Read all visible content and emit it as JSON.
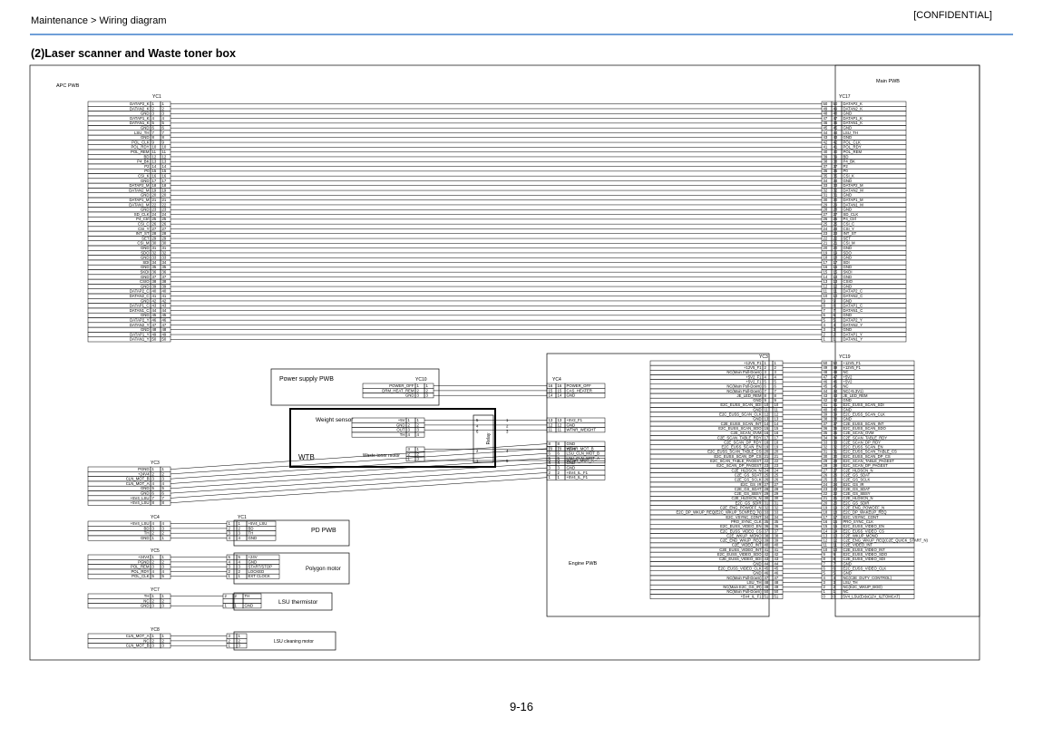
{
  "header": {
    "breadcrumb": "Maintenance > Wiring diagram",
    "confidential": "[CONFIDENTIAL]",
    "section_title": "(2)Laser scanner and Waste toner box",
    "page_number": "9-16"
  },
  "boards": {
    "apc": "APC PWB",
    "main": "Main PWB",
    "engine": "Engine PWB",
    "power": "Power supply PWB",
    "pd": "PD PWB",
    "weight": "Weight sensor",
    "waste_motor": "Waste toner motor",
    "wtb": "WTB",
    "relay": "Relay",
    "polygon": "Polygon motor",
    "lsu_th": "LSU thermistor",
    "lsu_clean": "LSU cleaning motor"
  },
  "connectors": {
    "yc1": "YC1",
    "yc17": "YC17",
    "yc3": "YC3",
    "yc19": "YC19",
    "yc10": "YC10",
    "yc4": "YC4",
    "yc5": "YC5",
    "yc7": "YC7",
    "yc8": "YC8"
  },
  "yc1_signals": [
    "DATAP2_K",
    "DATAN2_K",
    "GND",
    "DATAP1_K",
    "DATAN1_K",
    "GND",
    "LSU_TH",
    "GND",
    "POL_CLK",
    "POL_RDY",
    "POL_REM",
    "BD",
    "P4_BK",
    "P2",
    "P0",
    "CSI_K",
    "GND",
    "DATAP2_M",
    "DATAN2_M",
    "GND",
    "DATAP1_M",
    "DATAN1_M",
    "GND",
    "SD_CLK",
    "P4_Ctrl",
    "CSI_C",
    "CSI_Y",
    "INT_ST",
    "SET",
    "CSI_M",
    "GND",
    "SDO",
    "GND",
    "SDI",
    "GND",
    "SKDI",
    "GND",
    "CSIO",
    "GND",
    "DATAP2_C",
    "DATAN2_C",
    "GND",
    "DATAP1_C",
    "DATAN1_C",
    "GND",
    "DATAP2_Y",
    "DATAN2_Y",
    "GND",
    "DATAP1_Y",
    "DATAN1_Y"
  ],
  "yc17_signals": [
    "DATAP2_K",
    "DATAN2_K",
    "GND",
    "DATAP1_K",
    "DATAN1_K",
    "GND",
    "LSU_TH",
    "GND",
    "POL_CLK",
    "POL_RDY",
    "POL_REM",
    "BD",
    "P4_BK",
    "P2",
    "P0",
    "CSI_K",
    "GND",
    "DATAP2_M",
    "DATAN2_M",
    "GND",
    "DATAP1_M",
    "DATAN1_M",
    "GND",
    "SD_CLK",
    "P4_Ctrl",
    "CSI_C",
    "CSI_Y",
    "INT_ST",
    "SET",
    "CSI_M",
    "GND",
    "SDO",
    "GND",
    "SDI",
    "GND",
    "SKDI",
    "GND",
    "CSIO",
    "GND",
    "DATAP2_C",
    "DATAN2_C",
    "GND",
    "DATAP1_C",
    "DATAN1_C",
    "GND",
    "DATAP2_Y",
    "DATAN2_Y",
    "GND",
    "DATAP1_Y",
    "DATAN1_Y"
  ],
  "yc3_signals": [
    "+12V5_F1",
    "+12V5_F1",
    "NC(Main Pull-Down)",
    "+5V2_F1",
    "+5V2_F1",
    "NC(Main Pull-Down)",
    "NC(Main Pull-Down)",
    "JE_LED_REM",
    "GND",
    "E2C_EUSS_SCAN_SDI",
    "GND",
    "E2C_EUSS_SCAN_CLK",
    "GND",
    "C2E_EUSS_SCAN_INT",
    "E2C_EUSS_SCAN_SDO",
    "C2E_SCAN_OVM",
    "C2E_SCAN_TABLE_RDY",
    "C2E_SCAN_DP_RDY",
    "E2C_EUSS_SCAN_EN",
    "E2C_EUSS_SCAN_TABLE_CS",
    "E2C_EUSS_SCAN_DP_CS",
    "E2C_SCAN_TABLE_PAGEST",
    "E2C_SCAN_DP_PAGEST",
    "C2E_HLDSCN_N",
    "C2E_GS_SDAT",
    "C2E_GS_SCLK",
    "E2C_GS_IR",
    "C2E_GS_SDAT",
    "C2E_GS_SBSY",
    "C2E_HLDSCN_N",
    "E2C_GS_SDIR",
    "C2E_ENG_POWOFF_N",
    "E2C_DP_WKUP_REQ(E2C_WKUP_SCNREQ_N)",
    "E2C_VSYNC_CONT",
    "PRO_SYNC_CLK",
    "E2C_EUSS_VIDEO_EN",
    "E2C_EUSS_VIDEO_CS",
    "C2E_WKUP_MONO",
    "C2E_END_WKUP_REQ",
    "C2E_VIDEO_INT",
    "C2E_EUSS_VIDEO_INT",
    "E2C_EUSS_VIDEO_SDO",
    "C2E_EUSS_VIDEO_SDI",
    "GND",
    "E2C_EUSS_VIDEO_CLK",
    "GND",
    "NC(Main Pull-Down)",
    "LSU_TH",
    "NC(Main E2C_GS_IR)",
    "NC(Main Pull-Down)"
  ],
  "yc3_last": "+5V4_IL_F1",
  "yc19_signals": [
    "+12V5_F1",
    "+12V5_F1",
    "NC",
    "+5V2",
    "+5V2",
    "NC",
    "NC(+5.3V1)",
    "JE_LED_REM",
    "GND",
    "E2C_EUSS_SCAN_SDI",
    "GND",
    "E2C_EUSS_SCAN_CLK",
    "GND",
    "C2E_EUSS_SCAN_INT",
    "E2C_EUSS_SCAN_SDO",
    "C2E_SCAN_OVM",
    "C2E_SCAN_TABLE_RDY",
    "C2E_SCAN_DP_RDY",
    "E2C_EUSS_SCAN_EN",
    "E2C_EUSS_SCAN_TABLE_CS",
    "E2C_EUSS_SCAN_DP_CS",
    "E2C_SCAN_TABLE_PAGEST",
    "E2C_SCAN_DP_PAGEST",
    "C2E_HLDSCN_N",
    "C2E_GS_SDAT",
    "C2E_GS_SCLK",
    "E2C_GS_IR",
    "C2E_GS_SDAT",
    "C2E_GS_SBSY",
    "C2E_HLDSCN_N",
    "E2C_GS_SDIR",
    "C2E_ENG_POWOFF_N",
    "E2C_DP_WAKEUP_REQ",
    "E2C_VSYNC_CONT",
    "PRO_SYNC_CLK",
    "E2C_EUSS_VIDEO_EN",
    "E2C_EUSS_VIDEO_CS",
    "C2E_WKUP_MONO",
    "C2E_ENG_WKUP_REQ(C2E_QUICK_START_N)",
    "C2E_VIDEO_INT",
    "C2E_EUSS_VIDEO_INT",
    "E2C_EUSS_VIDEO_SDO",
    "C2E_EUSS_VIDEO_SDI",
    "GND",
    "E2C_EUSS_VIDEO_CLK",
    "GND",
    "NC(C2E_DUTY_CONTROL)",
    "LSU_TH",
    "NC(E2C_WKUP_BGD)",
    "NC"
  ],
  "yc19_last": "5V4_LSU(Ex)o(12V_IL(TOMCAT)",
  "yc10_signals": [
    "POWER_OFF",
    "DRM_HEAT_REM",
    "GND"
  ],
  "yc4_engine_signals": [
    "POWER_OFF",
    "CAS_HEATER",
    "GND",
    "+5V2_F1",
    "GND",
    "WTNR_WEIGHT",
    "WTNR_MOT_B",
    "WTNR_MOT_A",
    "GND",
    "+5V4",
    "LSU_CLN_MOT_B",
    "LSU_CLN_MOT_A",
    "GND",
    "GND",
    "+5V4_IL_F1",
    "+5V4_IL_F1"
  ],
  "yc4_engine_pins": [
    "16",
    "15",
    "14",
    "13",
    "12",
    "11",
    "10",
    "9",
    "8",
    "7",
    "6",
    "5",
    "4",
    "3",
    "2",
    "1"
  ],
  "weight_signals": [
    "+5V",
    "GND",
    "OUT",
    "TH"
  ],
  "apc_yc3_signals": [
    "PGND",
    "+24V4",
    "CLN_MOT_B",
    "CLN_MOT_A",
    "GND",
    "GND",
    "+5V4_LSU",
    "+5V4_LSU"
  ],
  "apc_yc4_signals": [
    "+5V4_LSU",
    "BD",
    "TH",
    "GND"
  ],
  "pd_yc1_signals": [
    "+5V4_LSU",
    "BD",
    "TH",
    "GND"
  ],
  "apc_yc5_signals": [
    "+24V4",
    "PGND",
    "POL_REM",
    "POL_RDY",
    "POL_CLK"
  ],
  "polygon_signals": [
    "+24V",
    "GND",
    "START/STOP",
    "LOCKED",
    "EXT CLOCK"
  ],
  "apc_yc7_signals": [
    "TH",
    "NC",
    "GND"
  ],
  "lsu_th_signals": [
    "TH",
    "GND"
  ],
  "apc_yc8_signals": [
    "CLN_MOT_A",
    "NC",
    "CLN_MOT_B"
  ]
}
